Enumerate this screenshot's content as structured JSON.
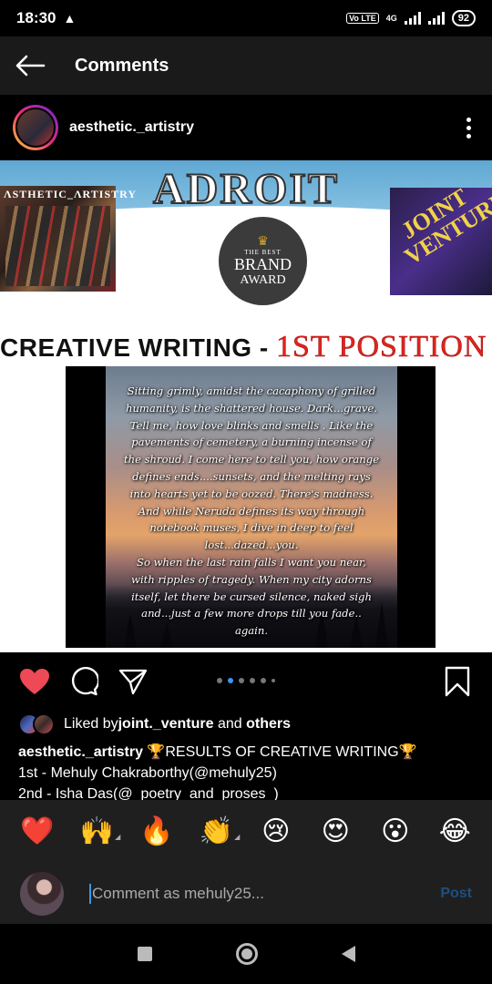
{
  "status": {
    "time": "18:30",
    "lte": "Vo LTE",
    "net": "4G",
    "battery": "92"
  },
  "header": {
    "title": "Comments"
  },
  "post": {
    "username": "aesthetic._artistry"
  },
  "image": {
    "banner_title": "ADROIT",
    "left_label": "ΛSTHETIC_ΛRTISTRY",
    "right_label": "JOINT VENTURE",
    "award_small": "THE BEST",
    "award_line1": "BRAND",
    "award_line2": "AWARD",
    "result_category": "CREATIVE WRITING - ",
    "result_position": "1ST POSITION",
    "poem_lines": [
      "Sitting grimly, amidst the cacaphony of grilled",
      "humanity, is the shattered house. Dark...grave.",
      "Tell me, how love blinks and smells . Like the",
      "pavements of cemetery, a burning incense of",
      "the shroud. I come here to tell you, how orange",
      "defines ends....sunsets, and the melting rays",
      "into hearts yet to be oozed. There's madness.",
      "And while Neruda defines its way through",
      "notebook muses, I dive in deep to feel",
      "lost...dazed...you.",
      "So when the last rain falls I want you near,",
      "with ripples of tragedy. When my city adorns",
      "itself, let there be cursed silence, naked sigh",
      "and...just a few more drops till you fade..",
      "again."
    ]
  },
  "likes": {
    "prefix": "Liked by ",
    "user": "joint._venture",
    "middle": " and ",
    "others": "others"
  },
  "caption": {
    "username": "aesthetic._artistry",
    "text": " 🏆RESULTS OF CREATIVE WRITING🏆",
    "line2": "1st - Mehuly Chakraborthy(@mehuly25)",
    "line3": "2nd - Isha Das(@_poetry_and_proses_)"
  },
  "emojis": [
    "❤️",
    "🙌",
    "🔥",
    "👏",
    "😢",
    "😍",
    "😮",
    "😂"
  ],
  "comment": {
    "placeholder": "Comment as mehuly25...",
    "post_label": "Post"
  },
  "colors": {
    "accent": "#3897f0",
    "like_red": "#ed4956",
    "position_red": "#e0241b"
  }
}
